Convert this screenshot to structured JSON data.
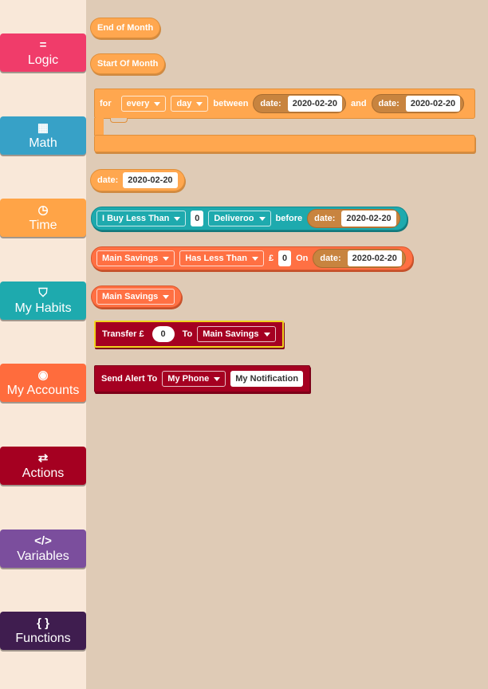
{
  "sidebar": {
    "categories": [
      {
        "label": "Logic",
        "icon": "=",
        "color": "#f03c6a"
      },
      {
        "label": "Math",
        "icon": "▦",
        "color": "#37a1c7"
      },
      {
        "label": "Time",
        "icon": "◷",
        "color": "#ffa447"
      },
      {
        "label": "My Habits",
        "icon": "⛉",
        "color": "#1eaaae"
      },
      {
        "label": "My Accounts",
        "icon": "◉",
        "color": "#ff6c3d"
      },
      {
        "label": "Actions",
        "icon": "⇄",
        "color": "#a50021"
      },
      {
        "label": "Variables",
        "icon": "</>",
        "color": "#7b4e9d"
      },
      {
        "label": "Functions",
        "icon": "{ }",
        "color": "#3f1d4f"
      }
    ]
  },
  "blocks": {
    "end_of_month": "End of Month",
    "start_of_month": "Start Of Month",
    "loop": {
      "for": "for",
      "every": "every",
      "day": "day",
      "between": "between",
      "and": "and",
      "date_label": "date:",
      "date1": "2020-02-20",
      "date2": "2020-02-20"
    },
    "date_block": {
      "label": "date:",
      "value": "2020-02-20"
    },
    "habit": {
      "condition": "I Buy Less Than",
      "amount": "0",
      "merchant": "Deliveroo",
      "before": "before",
      "date_label": "date:",
      "date": "2020-02-20"
    },
    "account_cond": {
      "account": "Main Savings",
      "condition": "Has Less Than",
      "currency": "£",
      "amount": "0",
      "on": "On",
      "date_label": "date:",
      "date": "2020-02-20"
    },
    "account": "Main Savings",
    "transfer": {
      "label": "Transfer £",
      "amount": "0",
      "to": "To",
      "account": "Main Savings"
    },
    "alert": {
      "label": "Send Alert To",
      "device": "My Phone",
      "message": "My Notification"
    }
  }
}
